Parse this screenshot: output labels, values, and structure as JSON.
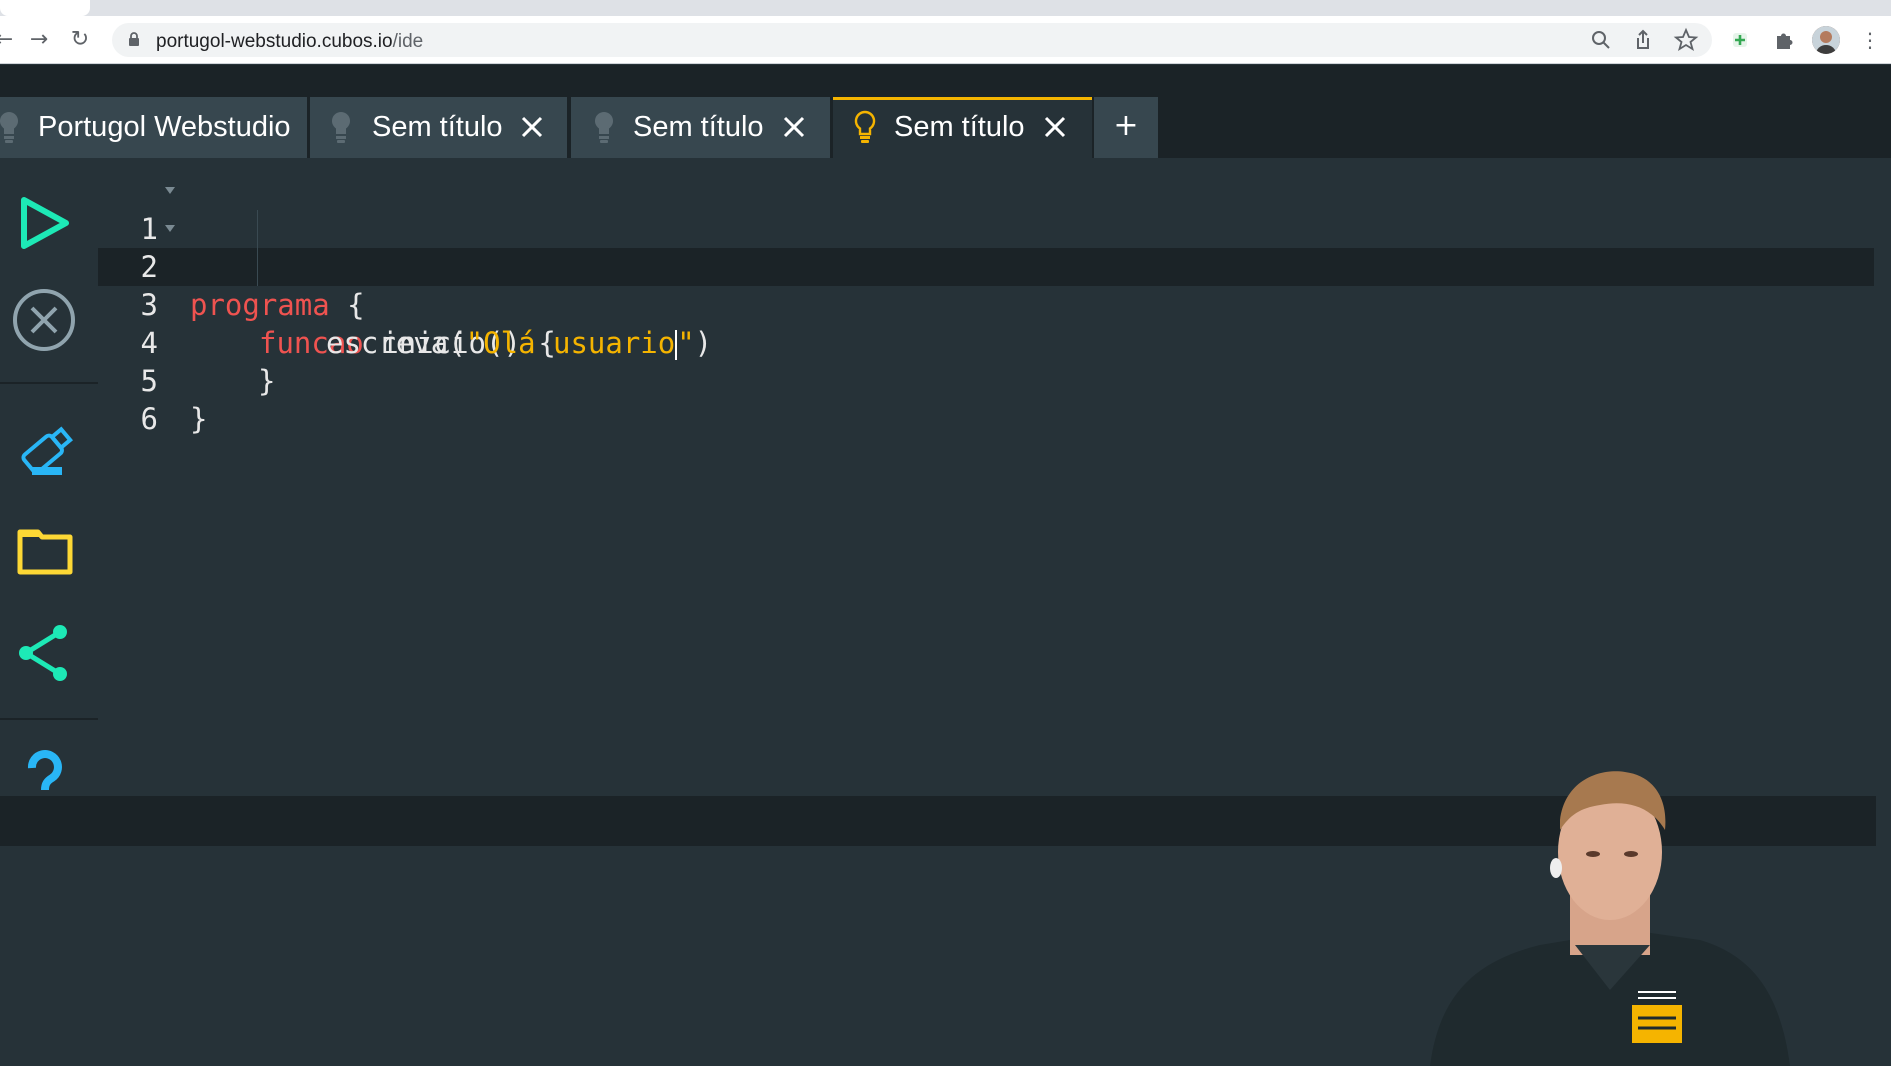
{
  "browser": {
    "url_host": "portugol-webstudio.cubos.io",
    "url_path": "/ide",
    "icons": [
      "back-icon",
      "forward-icon",
      "reload-icon",
      "lock-icon",
      "zoom-icon",
      "share-icon",
      "star-icon",
      "extension-plus-icon",
      "puzzle-icon",
      "profile-avatar",
      "kebab-menu-icon"
    ]
  },
  "tabs": [
    {
      "label": "Portugol Webstudio",
      "closable": false,
      "active": false
    },
    {
      "label": "Sem título",
      "closable": true,
      "active": false
    },
    {
      "label": "Sem título",
      "closable": true,
      "active": false
    },
    {
      "label": "Sem título",
      "closable": true,
      "active": true
    }
  ],
  "add_tab_label": "+",
  "sidebar": {
    "icons": [
      "run-icon",
      "stop-icon",
      "save-usb-icon",
      "folder-icon",
      "share-icon",
      "help-icon"
    ]
  },
  "editor": {
    "line_numbers": [
      "1",
      "2",
      "3",
      "4",
      "5",
      "6"
    ],
    "lines": {
      "l1_kw": "programa",
      "l1_rest": " {",
      "l2_kw": "funcao",
      "l2_rest": " inicio() {",
      "l3_fn": "escreva(",
      "l3_str_a": "\"Olá usuario",
      "l3_str_b": "\"",
      "l3_end": ")",
      "l4": "}",
      "l5": "}",
      "l6": ""
    },
    "active_line": 3
  },
  "colors": {
    "background": "#263238",
    "dark": "#1b2327",
    "tab": "#37474f",
    "accent": "#f5b400",
    "keyword": "#ef5350",
    "string": "#f5b400",
    "run": "#1de9b6",
    "stop": "#90a4ae",
    "save": "#29b6f6",
    "folder": "#fdd835",
    "share": "#1de9b6",
    "help": "#29b6f6"
  }
}
